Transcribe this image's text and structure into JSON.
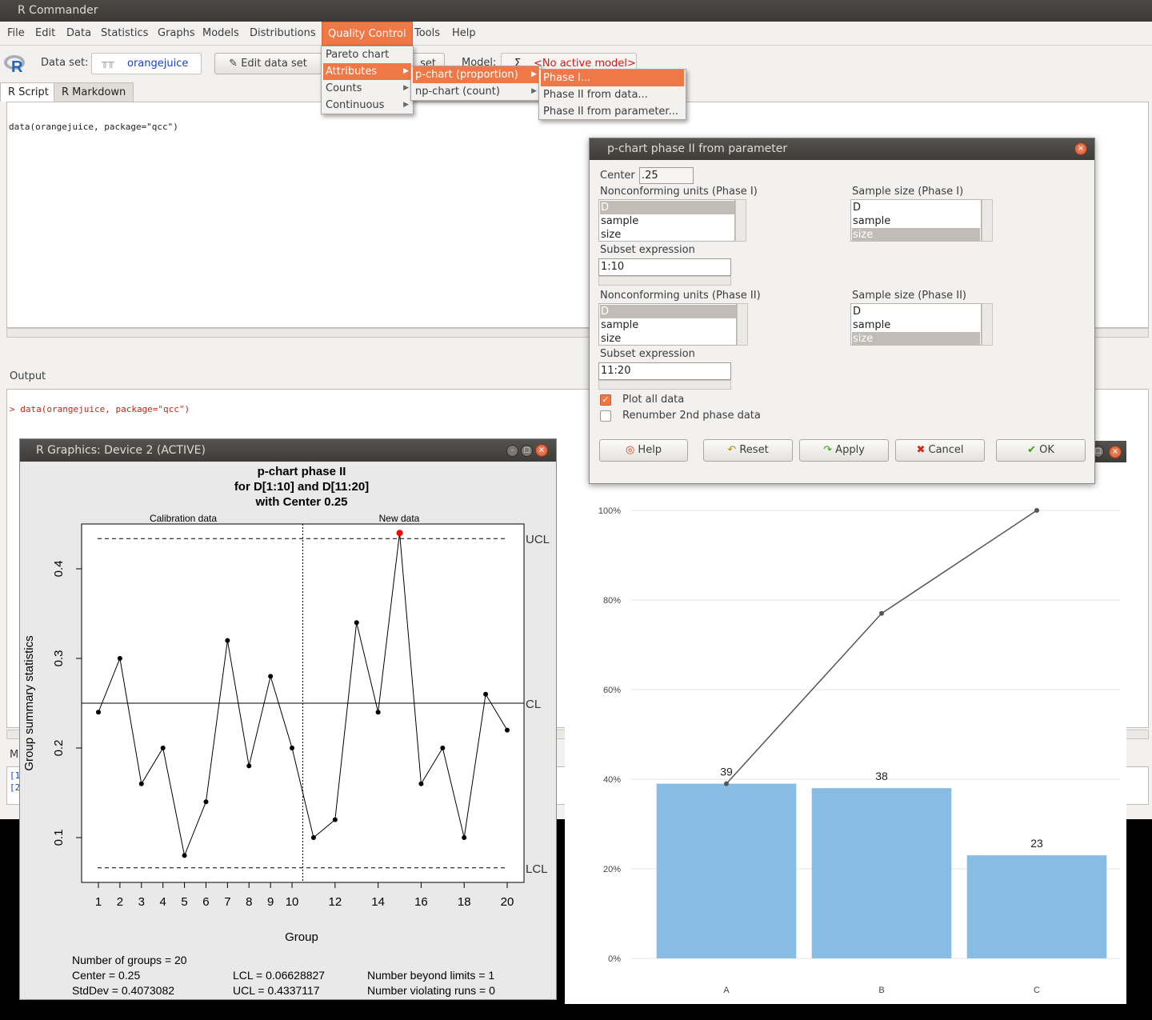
{
  "app": {
    "title": "R Commander"
  },
  "menubar": {
    "items": [
      "File",
      "Edit",
      "Data",
      "Statistics",
      "Graphs",
      "Models",
      "Distributions",
      "Quality Control",
      "Tools",
      "Help"
    ]
  },
  "toolbar": {
    "dataset_label": "Data set:",
    "dataset_value": "orangejuice",
    "edit_button": "Edit data set",
    "view_button_partial": "set",
    "model_label": "Model:",
    "model_sigma": "Σ",
    "model_value": "<No active model>"
  },
  "tabs": {
    "script": "R Script",
    "markdown": "R Markdown"
  },
  "script": {
    "line1": "data(orangejuice, package=\"qcc\")"
  },
  "output": {
    "label": "Output",
    "line1": "> data(orangejuice, package=\"qcc\")"
  },
  "messages": {
    "label_partial": "M",
    "line1": "[1",
    "line2": "[2"
  },
  "qc_menu": {
    "items": [
      "Pareto chart",
      "Attributes",
      "Counts",
      "Continuous"
    ]
  },
  "attr_menu": {
    "items": [
      "p-chart (proportion)",
      "np-chart (count)"
    ]
  },
  "pchart_menu": {
    "items": [
      "Phase I...",
      "Phase II from data...",
      "Phase II from parameter..."
    ]
  },
  "dialog": {
    "title": "p-chart phase II from parameter",
    "center_label": "Center",
    "center_value": ".25",
    "nonconf1_label": "Nonconforming units (Phase I)",
    "size1_label": "Sample size (Phase I)",
    "nonconf2_label": "Nonconforming units (Phase II)",
    "size2_label": "Sample size (Phase II)",
    "variables": [
      "D",
      "sample",
      "size"
    ],
    "subset_label": "Subset expression",
    "subset1_value": "1:10",
    "subset2_value": "11:20",
    "plot_all_label": "Plot all data",
    "renumber_label": "Renumber 2nd phase data",
    "buttons": {
      "help": "Help",
      "reset": "Reset",
      "apply": "Apply",
      "cancel": "Cancel",
      "ok": "OK"
    }
  },
  "graphics": {
    "title": "R Graphics: Device 2 (ACTIVE)",
    "stats": {
      "groups": "Number of groups = 20",
      "center": "Center = 0.25",
      "stddev": "StdDev = 0.4073082",
      "lcl": "LCL = 0.06628827",
      "ucl": "UCL = 0.4337117",
      "beyond": "Number beyond limits = 1",
      "violating": "Number violating runs = 0"
    }
  },
  "chart_data": [
    {
      "type": "line",
      "title": "p-chart phase II",
      "subtitle1": "for D[1:10] and D[11:20]",
      "subtitle2": "with Center 0.25",
      "xlabel": "Group",
      "ylabel": "Group summary statistics",
      "section_labels": [
        "Calibration data",
        "New data"
      ],
      "x": [
        1,
        2,
        3,
        4,
        5,
        6,
        7,
        8,
        9,
        10,
        11,
        12,
        13,
        14,
        15,
        16,
        17,
        18,
        19,
        20
      ],
      "values": [
        0.24,
        0.3,
        0.16,
        0.2,
        0.08,
        0.14,
        0.32,
        0.18,
        0.28,
        0.2,
        0.1,
        0.12,
        0.34,
        0.24,
        0.44,
        0.16,
        0.2,
        0.1,
        0.26,
        0.22
      ],
      "x_ticks": [
        1,
        2,
        3,
        4,
        5,
        6,
        7,
        8,
        9,
        10,
        12,
        14,
        16,
        18,
        20
      ],
      "y_ticks": [
        0.1,
        0.2,
        0.3,
        0.4
      ],
      "ylim": [
        0.05,
        0.45
      ],
      "center": 0.25,
      "ucl": 0.4337117,
      "lcl": 0.06628827,
      "limit_labels": [
        "UCL",
        "CL",
        "LCL"
      ],
      "out_of_control": [
        15
      ],
      "colors": {
        "point": "#000000",
        "violation": "#ff0000"
      }
    },
    {
      "type": "bar",
      "categories": [
        "A",
        "B",
        "C"
      ],
      "values": [
        39,
        38,
        23
      ],
      "cumulative_pct": [
        39,
        77,
        100
      ],
      "y_ticks": [
        "0%",
        "20%",
        "40%",
        "60%",
        "80%",
        "100%"
      ],
      "ylim": [
        0,
        100
      ],
      "bar_color": "#87bce4",
      "line_color": "#555555"
    }
  ]
}
